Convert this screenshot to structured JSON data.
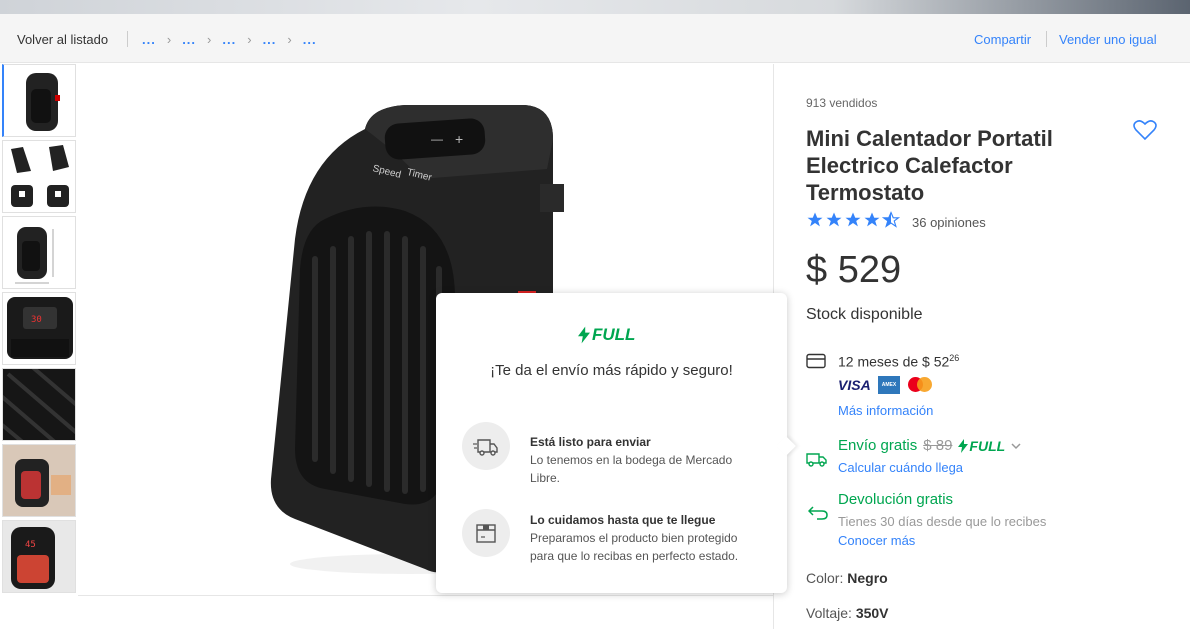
{
  "topbar": {
    "back_label": "Volver al listado",
    "breadcrumbs": [
      "...",
      "...",
      "...",
      "...",
      "..."
    ],
    "share_label": "Compartir",
    "sell_label": "Vender uno igual"
  },
  "product": {
    "sold": "913 vendidos",
    "title": "Mini Calentador Portatil Electrico Calefactor Termostato",
    "rating": 4.5,
    "reviews": "36 opiniones",
    "price": "$ 529",
    "stock": "Stock disponible"
  },
  "payment": {
    "installments": "12 meses de $ 52",
    "installments_cents": "26",
    "card_brands": [
      "VISA",
      "AMEX",
      "mastercard"
    ],
    "more_info": "Más información"
  },
  "shipping": {
    "free_label": "Envío gratis",
    "old_price": "$ 89",
    "full_label": "FULL",
    "calc_label": "Calcular cuándo llega"
  },
  "returns": {
    "label": "Devolución gratis",
    "subtitle": "Tienes 30 días desde que lo recibes",
    "more": "Conocer más"
  },
  "variations": {
    "color_label": "Color:",
    "color_value": "Negro",
    "voltage_label": "Voltaje:",
    "voltage_value": "350V"
  },
  "full_popover": {
    "badge": "FULL",
    "heading": "¡Te da el envío más rápido y seguro!",
    "items": [
      {
        "title": "Está listo para enviar",
        "desc": "Lo tenemos en la bodega de Mercado Libre."
      },
      {
        "title": "Lo cuidamos hasta que te llegue",
        "desc": "Preparamos el producto bien protegido para que lo recibas en perfecto estado."
      }
    ]
  },
  "heater_labels": [
    "Speed",
    "Timer"
  ],
  "colors": {
    "accent": "#3483fa",
    "green": "#00a650",
    "text": "#333333"
  }
}
